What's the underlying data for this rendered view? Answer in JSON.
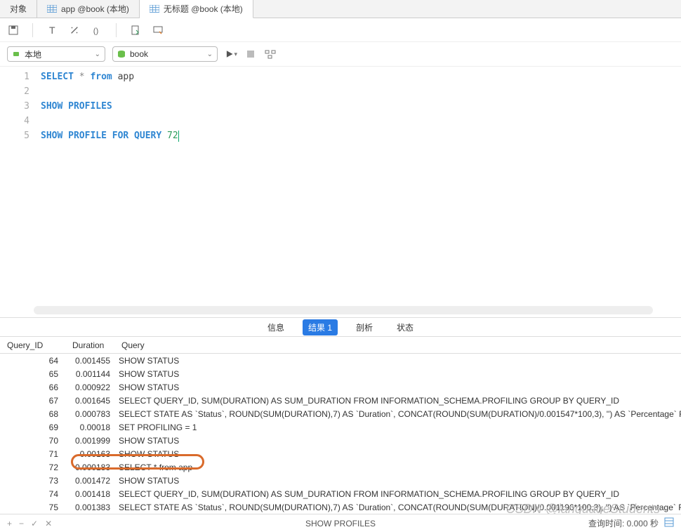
{
  "tabs": [
    {
      "label": "对象",
      "icon": null
    },
    {
      "label": "app @book (本地)",
      "icon": "table"
    },
    {
      "label": "无标题 @book (本地)",
      "icon": "table",
      "active": true
    }
  ],
  "controls": {
    "connection": "本地",
    "database": "book"
  },
  "editor": {
    "lines": [
      "1",
      "2",
      "3",
      "4",
      "5"
    ],
    "code_tokens": [
      [
        {
          "t": "SELECT",
          "c": "kw"
        },
        {
          "t": " ",
          "c": ""
        },
        {
          "t": "*",
          "c": "op"
        },
        {
          "t": " ",
          "c": ""
        },
        {
          "t": "from",
          "c": "kw"
        },
        {
          "t": " ",
          "c": ""
        },
        {
          "t": "app",
          "c": "id"
        }
      ],
      [],
      [
        {
          "t": "SHOW PROFILES",
          "c": "kw"
        }
      ],
      [],
      [
        {
          "t": "SHOW PROFILE FOR QUERY",
          "c": "kw"
        },
        {
          "t": " ",
          "c": ""
        },
        {
          "t": "72",
          "c": "num"
        }
      ]
    ]
  },
  "result_tabs": {
    "items": [
      "信息",
      "结果 1",
      "剖析",
      "状态"
    ],
    "active_index": 1
  },
  "grid": {
    "columns": [
      "Query_ID",
      "Duration",
      "Query"
    ],
    "rows": [
      {
        "id": "64",
        "dur": "0.001455",
        "q": "SHOW STATUS"
      },
      {
        "id": "65",
        "dur": "0.001144",
        "q": "SHOW STATUS"
      },
      {
        "id": "66",
        "dur": "0.000922",
        "q": "SHOW STATUS"
      },
      {
        "id": "67",
        "dur": "0.001645",
        "q": "SELECT QUERY_ID, SUM(DURATION) AS SUM_DURATION FROM INFORMATION_SCHEMA.PROFILING GROUP BY QUERY_ID"
      },
      {
        "id": "68",
        "dur": "0.000783",
        "q": "SELECT STATE AS `Status`, ROUND(SUM(DURATION),7) AS `Duration`, CONCAT(ROUND(SUM(DURATION)/0.001547*100,3), '') AS `Percentage` FROM"
      },
      {
        "id": "69",
        "dur": "0.00018",
        "q": "SET PROFILING = 1"
      },
      {
        "id": "70",
        "dur": "0.001999",
        "q": "SHOW STATUS"
      },
      {
        "id": "71",
        "dur": "0.00163",
        "q": "SHOW STATUS"
      },
      {
        "id": "72",
        "dur": "0.000183",
        "q": "SELECT * from app"
      },
      {
        "id": "73",
        "dur": "0.001472",
        "q": "SHOW STATUS"
      },
      {
        "id": "74",
        "dur": "0.001418",
        "q": "SELECT QUERY_ID, SUM(DURATION) AS SUM_DURATION FROM INFORMATION_SCHEMA.PROFILING GROUP BY QUERY_ID"
      },
      {
        "id": "75",
        "dur": "0.001383",
        "q": "SELECT STATE AS `Status`, ROUND(SUM(DURATION),7) AS `Duration`, CONCAT(ROUND(SUM(DURATION)/0.001196*100,3), '') AS `Percentage` FROM"
      }
    ]
  },
  "footer": {
    "center": "SHOW PROFILES",
    "right": "查询时间: 0.000 秒"
  },
  "watermark": "CSDN @languageStudents"
}
